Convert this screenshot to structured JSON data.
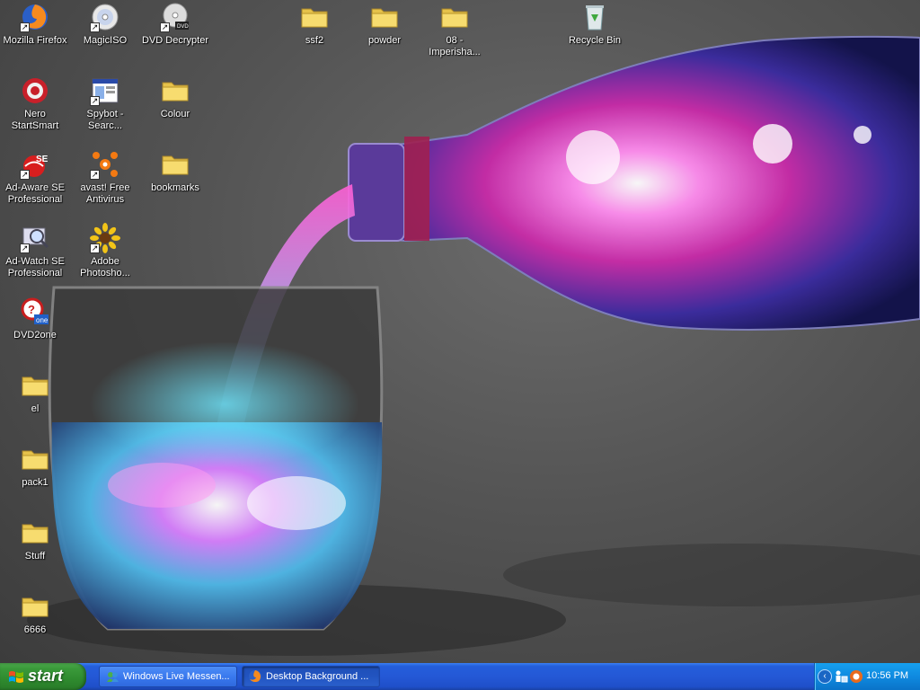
{
  "desktop": {
    "icons": [
      {
        "label": "Mozilla Firefox",
        "icon": "firefox-icon",
        "shortcut": true
      },
      {
        "label": "MagicISO",
        "icon": "disc-icon",
        "shortcut": true
      },
      {
        "label": "DVD Decrypter",
        "icon": "dvd-icon",
        "shortcut": true
      },
      {
        "label": "ssf2",
        "icon": "folder-icon"
      },
      {
        "label": "powder",
        "icon": "folder-icon"
      },
      {
        "label": "08 - Imperisha...",
        "icon": "folder-icon"
      },
      {
        "label": "Recycle Bin",
        "icon": "recycle-bin-icon"
      },
      {
        "label": "Nero StartSmart",
        "icon": "nero-icon"
      },
      {
        "label": "Spybot - Searc...",
        "icon": "spybot-icon",
        "shortcut": true
      },
      {
        "label": "Colour",
        "icon": "folder-icon"
      },
      {
        "label": "Ad-Aware SE Professional",
        "icon": "adaware-icon",
        "shortcut": true
      },
      {
        "label": "avast! Free Antivirus",
        "icon": "avast-icon",
        "shortcut": true
      },
      {
        "label": "bookmarks",
        "icon": "folder-icon"
      },
      {
        "label": "Ad-Watch SE Professional",
        "icon": "adwatch-icon",
        "shortcut": true
      },
      {
        "label": "Adobe Photosho...",
        "icon": "photoshop-icon",
        "shortcut": true
      },
      {
        "label": "DVD2one",
        "icon": "dvd2one-icon"
      },
      {
        "label": "el",
        "icon": "folder-icon"
      },
      {
        "label": "pack1",
        "icon": "folder-icon"
      },
      {
        "label": "Stuff",
        "icon": "folder-icon"
      },
      {
        "label": "6666",
        "icon": "folder-icon"
      }
    ]
  },
  "taskbar": {
    "start_label": "start",
    "tasks": [
      {
        "label": "Windows Live Messen...",
        "icon": "messenger-icon",
        "active": false
      },
      {
        "label": "Desktop Background ...",
        "icon": "firefox-icon",
        "active": true
      }
    ],
    "tray": {
      "icons": [
        "network-users-icon",
        "update-icon"
      ],
      "clock": "10:56 PM"
    }
  },
  "colors": {
    "taskbar_blue": "#245edb",
    "start_green": "#3a9a3a",
    "tray_blue": "#0f8ae0"
  }
}
